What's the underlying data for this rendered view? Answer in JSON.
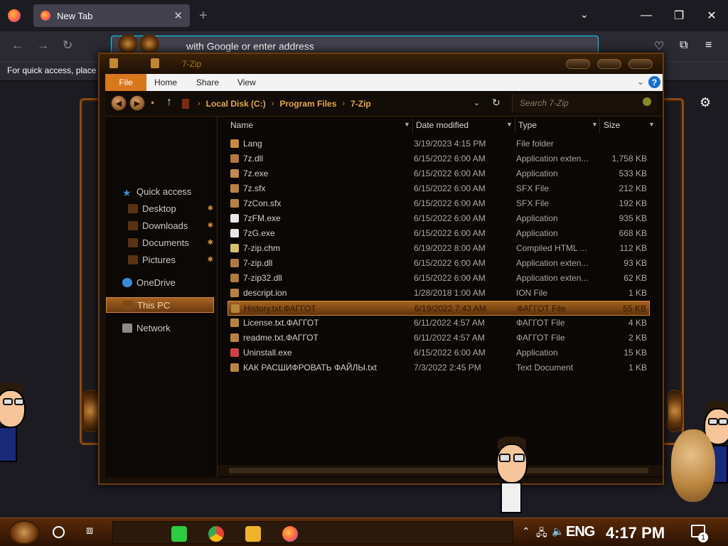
{
  "firefox": {
    "tab_title": "New Tab",
    "url_placeholder": "with Google or enter address",
    "banner_text": "For quick access, place y"
  },
  "explorer": {
    "window_title": "7-Zip",
    "ribbon": {
      "file": "File",
      "home": "Home",
      "share": "Share",
      "view": "View",
      "help": "?"
    },
    "breadcrumb": [
      "Local Disk (C:)",
      "Program Files",
      "7-Zip"
    ],
    "search_placeholder": "Search 7-Zip",
    "nav": {
      "quick_access": "Quick access",
      "desktop": "Desktop",
      "downloads": "Downloads",
      "documents": "Documents",
      "pictures": "Pictures",
      "onedrive": "OneDrive",
      "this_pc": "This PC",
      "network": "Network"
    },
    "columns": {
      "name": "Name",
      "date": "Date modified",
      "type": "Type",
      "size": "Size"
    },
    "files": [
      {
        "name": "Lang",
        "date": "3/19/2023 4:15 PM",
        "type": "File folder",
        "size": "",
        "icon": "folder"
      },
      {
        "name": "7z.dll",
        "date": "6/15/2022 6:00 AM",
        "type": "Application exten...",
        "size": "1,758 KB",
        "icon": "dll"
      },
      {
        "name": "7z.exe",
        "date": "6/15/2022 6:00 AM",
        "type": "Application",
        "size": "533 KB",
        "icon": "exe"
      },
      {
        "name": "7z.sfx",
        "date": "6/15/2022 6:00 AM",
        "type": "SFX File",
        "size": "212 KB",
        "icon": "file"
      },
      {
        "name": "7zCon.sfx",
        "date": "6/15/2022 6:00 AM",
        "type": "SFX File",
        "size": "192 KB",
        "icon": "file"
      },
      {
        "name": "7zFM.exe",
        "date": "6/15/2022 6:00 AM",
        "type": "Application",
        "size": "935 KB",
        "icon": "7z"
      },
      {
        "name": "7zG.exe",
        "date": "6/15/2022 6:00 AM",
        "type": "Application",
        "size": "668 KB",
        "icon": "7z"
      },
      {
        "name": "7-zip.chm",
        "date": "6/19/2022 8:00 AM",
        "type": "Compiled HTML ...",
        "size": "112 KB",
        "icon": "chm"
      },
      {
        "name": "7-zip.dll",
        "date": "6/15/2022 6:00 AM",
        "type": "Application exten...",
        "size": "93 KB",
        "icon": "dll"
      },
      {
        "name": "7-zip32.dll",
        "date": "6/15/2022 6:00 AM",
        "type": "Application exten...",
        "size": "62 KB",
        "icon": "dll"
      },
      {
        "name": "descript.ion",
        "date": "1/28/2018 1:00 AM",
        "type": "ION File",
        "size": "1 KB",
        "icon": "file"
      },
      {
        "name": "History.txt.ФАГГОТ",
        "date": "6/19/2022 7:43 AM",
        "type": "ФАГГОТ File",
        "size": "55 KB",
        "icon": "file",
        "selected": true
      },
      {
        "name": "License.txt.ФАГГОТ",
        "date": "6/11/2022 4:57 AM",
        "type": "ФАГГОТ File",
        "size": "4 KB",
        "icon": "file"
      },
      {
        "name": "readme.txt.ФАГГОТ",
        "date": "6/11/2022 4:57 AM",
        "type": "ФАГГОТ File",
        "size": "2 KB",
        "icon": "file"
      },
      {
        "name": "Uninstall.exe",
        "date": "6/15/2022 6:00 AM",
        "type": "Application",
        "size": "15 KB",
        "icon": "uninstall"
      },
      {
        "name": "КАК РАСШИФРОВАТЬ ФАЙЛЫ.txt",
        "date": "7/3/2022 2:45 PM",
        "type": "Text Document",
        "size": "1 KB",
        "icon": "file"
      }
    ]
  },
  "taskbar": {
    "language": "ENG",
    "time": "4:17 PM",
    "notification_count": "1"
  },
  "colors": {
    "accent": "#d9771b",
    "frame": "#6b3a10",
    "selection": "#a66220"
  }
}
